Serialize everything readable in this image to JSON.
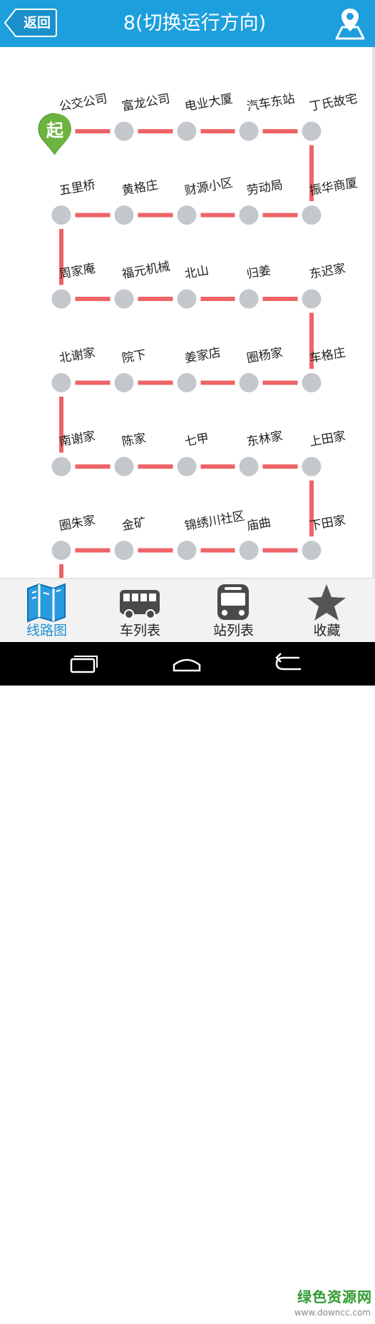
{
  "header": {
    "back_label": "返回",
    "title": "8(切换运行方向)",
    "map_icon": "map-location-icon"
  },
  "route": {
    "start_marker_label": "起",
    "line_color": "#ee6366",
    "stop_color": "#c4c8cc",
    "rows": [
      [
        "公交公司",
        "富龙公司",
        "电业大厦",
        "汽车东站",
        "丁氏故宅"
      ],
      [
        "五里桥",
        "黄格庄",
        "财源小区",
        "劳动局",
        "振华商厦"
      ],
      [
        "周家庵",
        "福元机械",
        "北山",
        "归姜",
        "东迟家"
      ],
      [
        "北谢家",
        "院下",
        "姜家店",
        "圈杨家",
        "车格庄"
      ],
      [
        "南谢家",
        "陈家",
        "七甲",
        "东林家",
        "上田家"
      ],
      [
        "圈朱家",
        "金矿",
        "锦绣川社区",
        "庙曲",
        "下田家"
      ]
    ]
  },
  "tabs": [
    {
      "label": "线路图",
      "icon": "route-map-icon",
      "active": true
    },
    {
      "label": "车列表",
      "icon": "bus-side-icon",
      "active": false
    },
    {
      "label": "站列表",
      "icon": "bus-front-icon",
      "active": false
    },
    {
      "label": "收藏",
      "icon": "star-icon",
      "active": false
    }
  ],
  "system_nav": {
    "recents_icon": "recents-icon",
    "home_icon": "home-icon",
    "back_icon": "back-arrow-icon"
  },
  "watermark": {
    "main": "绿色资源网",
    "sub": "www.downcc.com"
  },
  "colors": {
    "header_bg": "#1e9fdd",
    "active_tab": "#1e8fd4",
    "start_marker": "#6cb33f"
  }
}
